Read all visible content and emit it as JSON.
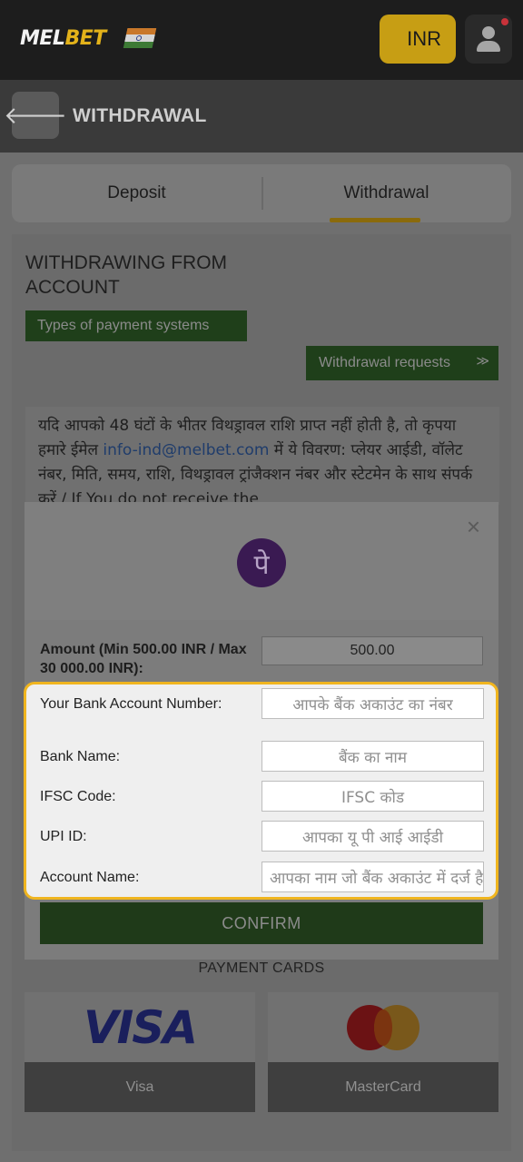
{
  "topbar": {
    "logo": {
      "mel": "MEL",
      "bet": "BET"
    },
    "flag_icon": "india-flag-icon",
    "currency": "INR",
    "user_icon": "user-icon"
  },
  "header": {
    "back_icon": "arrow-left-icon",
    "back_glyph": "🡐",
    "title": "WITHDRAWAL"
  },
  "tabs": [
    {
      "label": "Deposit",
      "active": false
    },
    {
      "label": "Withdrawal",
      "active": true
    }
  ],
  "panel": {
    "title": "WITHDRAWING FROM ACCOUNT",
    "types_button": "Types of payment systems",
    "requests_button": "Withdrawal requests",
    "requests_chevron": "≫",
    "notice_before": "यदि आपको 48 घंटों के भीतर विथड्रावल राशि प्राप्त नहीं होती है, तो कृपया हमारे ईमेल ",
    "notice_email": "info-ind@melbet.com",
    "notice_after": " में ये विवरण: प्लेयर आईडी, वॉलेट नंबर, मिति, समय, राशि, विथड्रावल ट्रांजैक्शन नंबर और स्टेटमेन के साथ संपर्क करें / If You do not receive the"
  },
  "modal": {
    "close_glyph": "×",
    "logo_glyph": "पे",
    "amount_label": "Amount (Min 500.00 INR / Max 30 000.00 INR):",
    "amount_value": "500.00",
    "fields": [
      {
        "label": "Your Bank Account Number:",
        "placeholder": "आपके बैंक अकाउंट का नंबर"
      },
      {
        "label": "Bank Name:",
        "placeholder": "बैंक का नाम"
      },
      {
        "label": "IFSC Code:",
        "placeholder": "IFSC कोड"
      },
      {
        "label": "UPI ID:",
        "placeholder": "आपका यू पी आई आईडी"
      },
      {
        "label": "Account Name:",
        "placeholder": "आपका नाम जो बैंक अकाउंट में दर्ज है"
      }
    ],
    "confirm": "CONFIRM"
  },
  "payment_cards": {
    "heading": "PAYMENT CARDS",
    "cards": [
      {
        "name": "Visa",
        "mark": "VISA"
      },
      {
        "name": "MasterCard"
      }
    ]
  },
  "colors": {
    "accent": "#f0b51f",
    "brand_yellow": "#e3b21a",
    "confirm_green": "#1f3a19"
  }
}
